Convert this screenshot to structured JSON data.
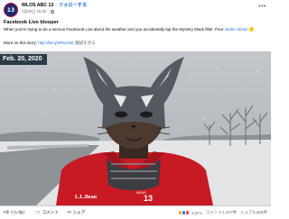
{
  "post": {
    "page_name": "WLOS ABC 13",
    "follow_label": "フォローする",
    "timestamp": "2月20日 19:30",
    "title": "Facebook Live blooper",
    "description_before": "When you're trying to do a serious Facebook Live about the weather and you accidentally tap the Mystery Mask filter. Poor ",
    "description_link": "Justin Hinton",
    "more_prefix": "More on this story: ",
    "more_link": "http://bit.ly/2Pwr1kK",
    "translate_label": "翻訳を見る",
    "avatar_text": "13"
  },
  "video": {
    "date_badge": "Feb. 20, 2020",
    "jacket_brand": "L.L.Bean",
    "jacket_logo_line1": "NEWS",
    "jacket_logo_line2": "13"
  },
  "footer": {
    "like_label": "いいね！",
    "comment_label": "コメント",
    "share_label": "シェア",
    "reaction_count": "4,572",
    "comments": "コメント1,437件",
    "shares": "シェア4,469件"
  },
  "colors": {
    "link": "#216fdb",
    "jacket": "#c81a24",
    "badge": "#2b3a48"
  },
  "icons": [
    "more-icon",
    "globe-icon",
    "like-icon",
    "comment-icon",
    "share-icon",
    "haha-reaction-icon",
    "like-reaction-icon",
    "love-reaction-icon"
  ]
}
